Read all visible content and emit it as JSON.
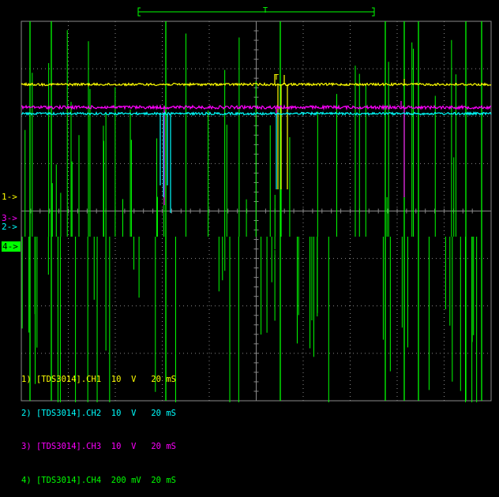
{
  "instrument": "TDS3014",
  "colors": {
    "background": "#000000",
    "grid": "#8a8a8a",
    "ch1": "#ffff00",
    "ch2": "#00ffff",
    "ch3": "#ff00ff",
    "ch4": "#00ff00"
  },
  "channel_markers": [
    {
      "label": "1->"
    },
    {
      "label": "3->"
    },
    {
      "label": "2->"
    },
    {
      "label": "4->"
    }
  ],
  "legend": [
    {
      "text": "1) [TDS3014].CH1  10  V   20 mS"
    },
    {
      "text": "2) [TDS3014].CH2  10  V   20 mS"
    },
    {
      "text": "3) [TDS3014].CH3  10  V   20 mS"
    },
    {
      "text": "4) [TDS3014].CH4  200 mV  20 mS"
    }
  ],
  "trigger_marker": "T",
  "chart_data": {
    "type": "line",
    "grid": true,
    "series": [
      {
        "name": "CH1",
        "volts_per_div": 10,
        "time_per_div": "20 mS",
        "description": "flat DC level near top with short spikes"
      },
      {
        "name": "CH2",
        "volts_per_div": 10,
        "time_per_div": "20 mS",
        "description": "flat DC level with downward spikes"
      },
      {
        "name": "CH3",
        "volts_per_div": 10,
        "time_per_div": "20 mS",
        "description": "flat DC level with small ripples"
      },
      {
        "name": "CH4",
        "volts_per_div": 0.2,
        "time_per_div": "20 mS",
        "description": "noisy signal with large random spikes"
      }
    ]
  }
}
